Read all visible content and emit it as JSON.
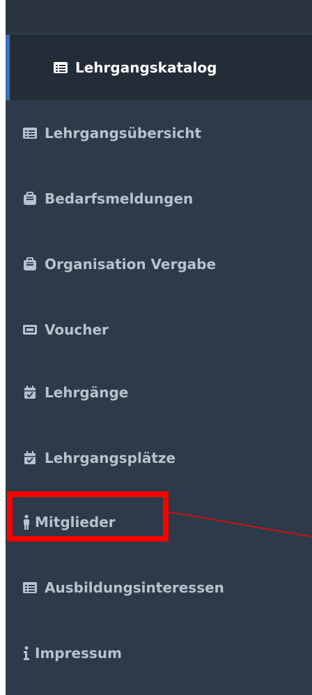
{
  "sidebar": {
    "items": [
      {
        "label": "Lehrgangskatalog",
        "icon": "list-card-icon",
        "active": true
      },
      {
        "label": "Lehrgangsübersicht",
        "icon": "list-card-icon"
      },
      {
        "label": "Bedarfsmeldungen",
        "icon": "briefcase-icon"
      },
      {
        "label": "Organisation Vergabe",
        "icon": "briefcase-icon"
      },
      {
        "label": "Voucher",
        "icon": "ticket-icon"
      },
      {
        "label": "Lehrgänge",
        "icon": "calendar-check-icon"
      },
      {
        "label": "Lehrgangsplätze",
        "icon": "calendar-check-icon"
      },
      {
        "label": "Mitglieder",
        "icon": "person-icon"
      },
      {
        "label": "Ausbildungsinteressen",
        "icon": "list-card-icon"
      },
      {
        "label": "Impressum",
        "icon": "info-icon"
      }
    ]
  },
  "colors": {
    "sidebar_bg": "#2d3a4a",
    "active_bg": "#222d38",
    "active_accent": "#3b6fb6",
    "text": "#b8c1cc",
    "annotation": "#ff0000"
  }
}
